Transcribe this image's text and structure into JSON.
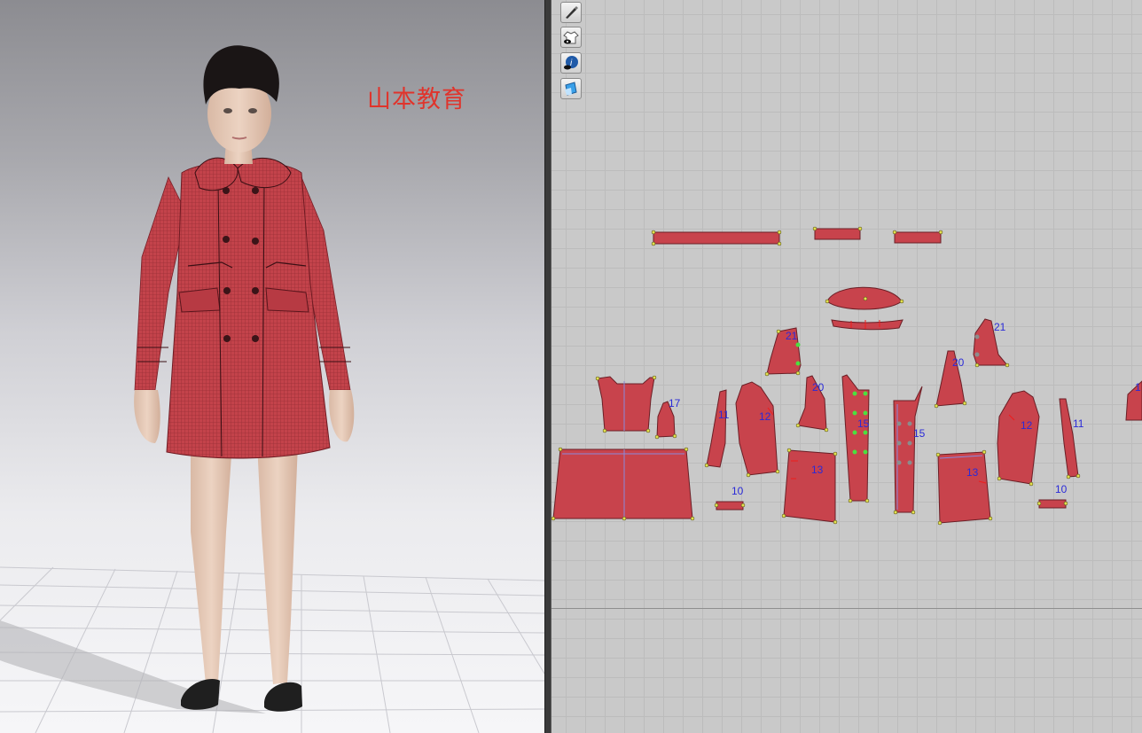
{
  "app": {
    "watermark": "山本教育"
  },
  "toolbar": {
    "tools": [
      {
        "name": "pen-tool-icon"
      },
      {
        "name": "garment-visibility-icon"
      },
      {
        "name": "info-visibility-icon"
      },
      {
        "name": "texture-icon"
      }
    ]
  },
  "pattern_labels": {
    "p21a": "21",
    "p21b": "21",
    "p20a": "20",
    "p20b": "20",
    "p17": "17",
    "p11a": "11",
    "p11b": "11",
    "p12a": "12",
    "p12b": "12",
    "p15a": "15",
    "p15b": "15",
    "p13a": "13",
    "p13b": "13",
    "p10a": "10",
    "p10b": "10",
    "pEdge": "1"
  },
  "colors": {
    "fabric": "#c8434c",
    "fabric_dark": "#a8323a",
    "label": "#2a2ad8",
    "watermark": "#e0342c"
  }
}
